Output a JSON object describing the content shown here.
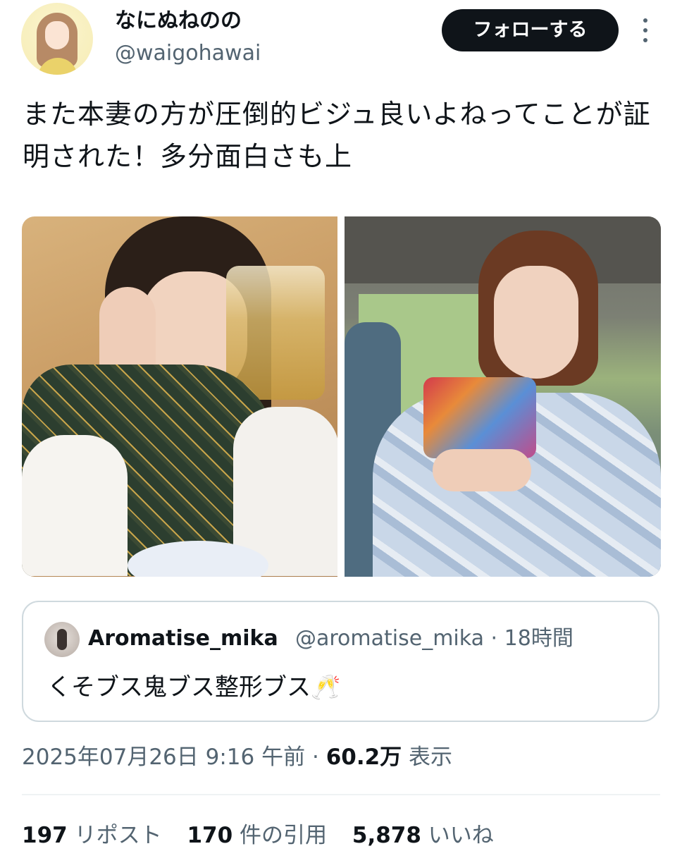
{
  "author": {
    "display_name": "なにぬねのの",
    "handle": "@waigohawai",
    "follow_label": "フォローする"
  },
  "tweet": {
    "text": "また本妻の方が圧倒的ビジュ良いよねってことが証明された！多分面白さも上"
  },
  "media": [
    {
      "icon": "photo-woman-with-beer"
    },
    {
      "icon": "photo-woman-in-yukata"
    }
  ],
  "quoted": {
    "display_name": "Aromatise_mika",
    "handle": "@aromatise_mika",
    "separator": "·",
    "time": "18時間",
    "text": "くそブス鬼ブス整形ブス🥂"
  },
  "meta": {
    "timestamp": "2025年07月26日 9:16 午前",
    "separator": "·",
    "views": "60.2万",
    "views_label": "表示"
  },
  "stats": {
    "reposts": "197",
    "reposts_label": "リポスト",
    "quotes": "170",
    "quotes_label": "件の引用",
    "likes": "5,878",
    "likes_label": "いいね"
  },
  "colors": {
    "text": "#0f1419",
    "secondary": "#536471",
    "border": "#cfd9de",
    "button": "#0f1419"
  }
}
